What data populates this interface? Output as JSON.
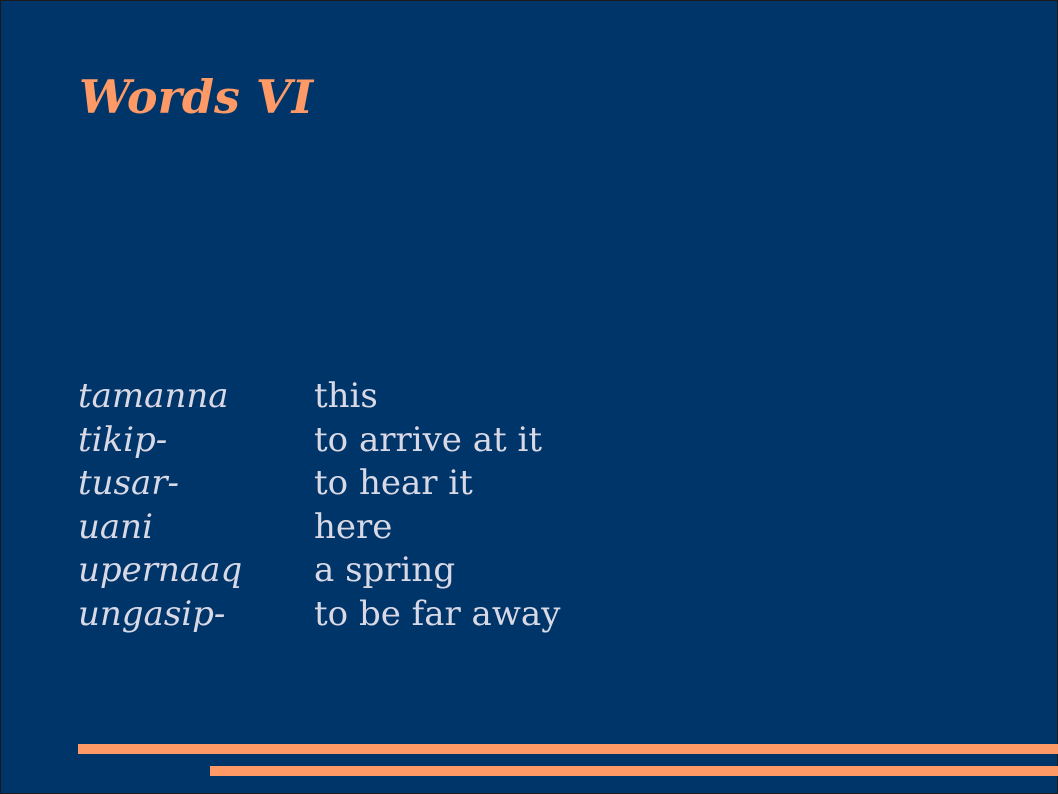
{
  "slide": {
    "title": "Words VI",
    "colors": {
      "background": "#00356a",
      "title": "#ff9966",
      "body_text": "#d9d9e6",
      "accent_rules": "#ff9966"
    },
    "words": [
      {
        "term": "tamanna",
        "gloss": "this"
      },
      {
        "term": "tikip-",
        "gloss": "to arrive at it"
      },
      {
        "term": "tusar-",
        "gloss": "to hear it"
      },
      {
        "term": "uani",
        "gloss": "here"
      },
      {
        "term": "upernaaq",
        "gloss": "a spring"
      },
      {
        "term": "ungasip-",
        "gloss": "to be far away"
      }
    ]
  }
}
